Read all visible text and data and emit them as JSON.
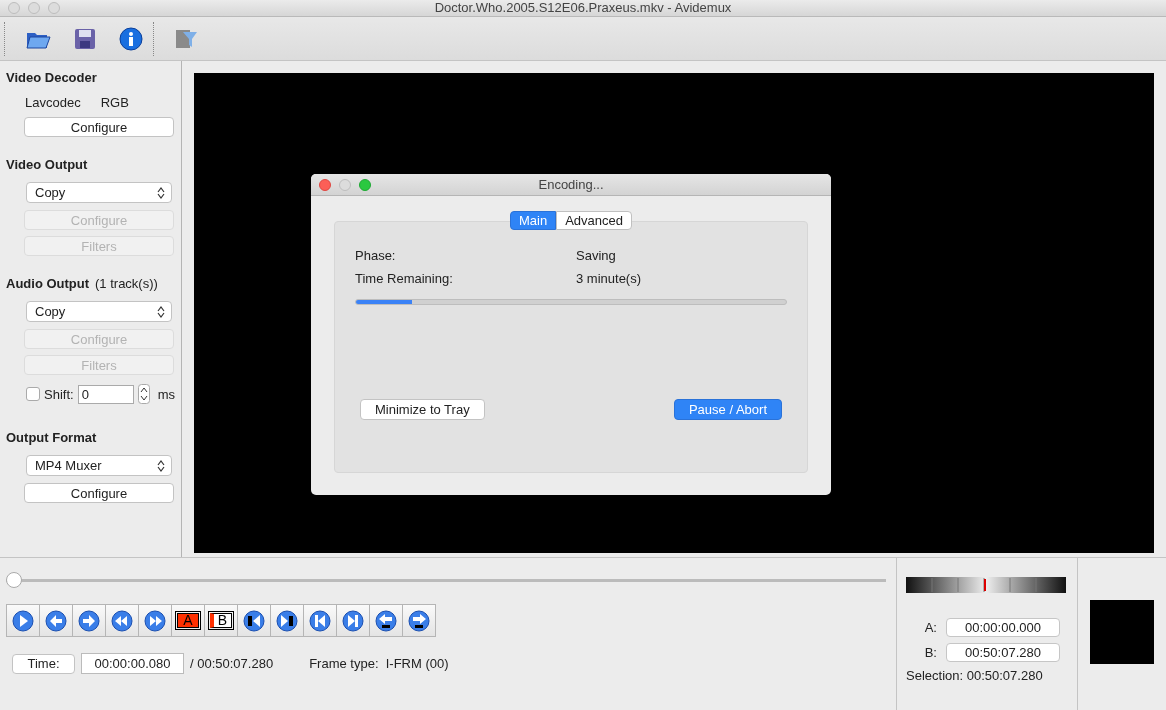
{
  "window": {
    "title": "Doctor.Who.2005.S12E06.Praxeus.mkv - Avidemux"
  },
  "sidebar": {
    "items": [
      {
        "kind": "heading",
        "label": "Video Decoder"
      },
      {
        "kind": "pair",
        "values": [
          "Lavcodec",
          "RGB"
        ]
      },
      {
        "kind": "button",
        "label": "Configure",
        "disabled": false
      },
      {
        "kind": "heading",
        "label": "Video Output"
      },
      {
        "kind": "select",
        "value": "Copy"
      },
      {
        "kind": "button",
        "label": "Configure",
        "disabled": true
      },
      {
        "kind": "button",
        "label": "Filters",
        "disabled": true
      },
      {
        "kind": "heading",
        "label": "Audio Output",
        "note": "(1 track(s))"
      },
      {
        "kind": "select",
        "value": "Copy"
      },
      {
        "kind": "button",
        "label": "Configure",
        "disabled": true
      },
      {
        "kind": "button",
        "label": "Filters",
        "disabled": true
      },
      {
        "kind": "shift",
        "label": "Shift:",
        "checked": false,
        "value": "0",
        "unit": "ms"
      },
      {
        "kind": "heading",
        "label": "Output Format"
      },
      {
        "kind": "select",
        "value": "MP4 Muxer"
      },
      {
        "kind": "button",
        "label": "Configure",
        "disabled": false
      }
    ]
  },
  "dialog": {
    "title": "Encoding...",
    "tabs": [
      {
        "label": "Main",
        "selected": true
      },
      {
        "label": "Advanced",
        "selected": false
      }
    ],
    "rows": [
      {
        "label": "Phase:",
        "value": "Saving"
      },
      {
        "label": "Time Remaining:",
        "value": "3 minute(s)"
      }
    ],
    "progress": {
      "level": 0.13
    },
    "buttons": [
      {
        "label": "Minimize to Tray",
        "default": false
      },
      {
        "label": "Pause / Abort",
        "default": true
      }
    ]
  },
  "seek": {
    "level": 0
  },
  "transport": [
    {
      "kind": "play"
    },
    {
      "kind": "prev"
    },
    {
      "kind": "next"
    },
    {
      "kind": "rewind"
    },
    {
      "kind": "forward"
    },
    {
      "kind": "mark",
      "label": "A"
    },
    {
      "kind": "mark",
      "label": "B"
    },
    {
      "kind": "prev-black"
    },
    {
      "kind": "next-black"
    },
    {
      "kind": "first"
    },
    {
      "kind": "last"
    },
    {
      "kind": "back-60"
    },
    {
      "kind": "fwd-60"
    }
  ],
  "time": {
    "button": "Time:",
    "value": "00:00:00.080",
    "duration": "/ 00:50:07.280",
    "frame_type": "Frame type:  I-FRM (00)"
  },
  "selection": {
    "a_label": "A:",
    "a_value": "00:00:00.000",
    "b_label": "B:",
    "b_value": "00:50:07.280",
    "summary": "Selection: 00:50:07.280"
  }
}
